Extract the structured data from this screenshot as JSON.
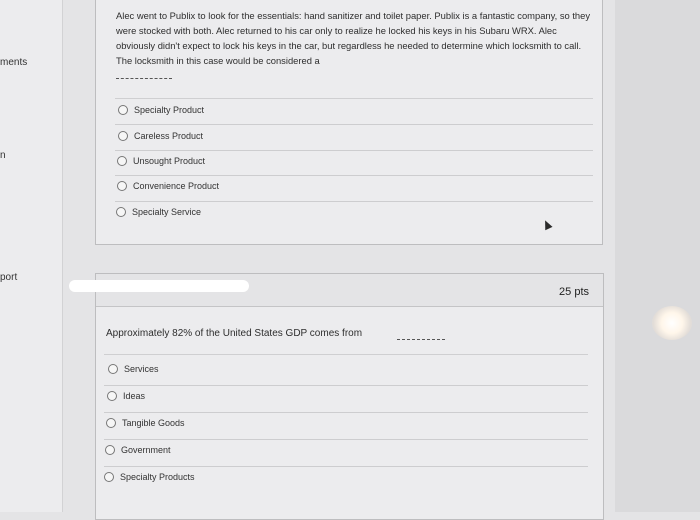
{
  "sidebar": {
    "items": [
      {
        "label": "ments"
      },
      {
        "label": "n"
      },
      {
        "label": "port"
      }
    ]
  },
  "question1": {
    "text": "Alec went to Publix to look for the essentials: hand sanitizer and toilet paper. Publix is a fantastic company, so they were stocked with both. Alec returned to his car only to realize he locked his keys in his Subaru WRX. Alec obviously didn't expect to lock his keys in the car, but regardless he needed to determine which locksmith to call. The locksmith in this case would be considered a",
    "options": [
      {
        "label": "Specialty Product"
      },
      {
        "label": "Careless Product"
      },
      {
        "label": "Unsought Product"
      },
      {
        "label": "Convenience Product"
      },
      {
        "label": "Specialty Service"
      }
    ]
  },
  "question2": {
    "points": "25 pts",
    "text": "Approximately 82% of the United States GDP comes from",
    "options": [
      {
        "label": "Services"
      },
      {
        "label": "Ideas"
      },
      {
        "label": "Tangible Goods"
      },
      {
        "label": "Government"
      },
      {
        "label": "Specialty Products"
      }
    ]
  }
}
